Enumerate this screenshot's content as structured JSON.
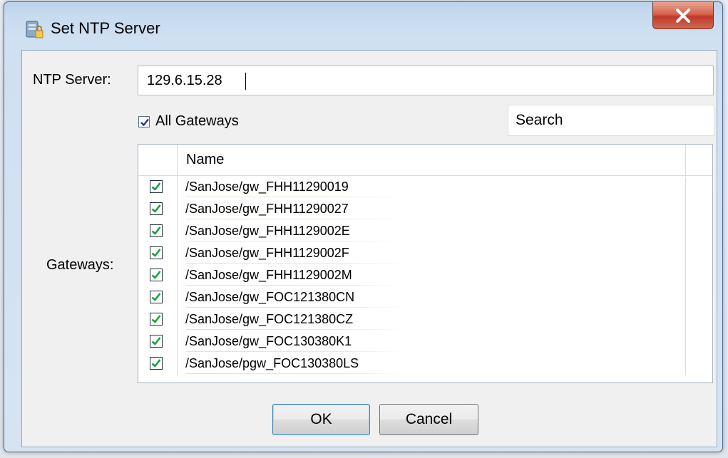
{
  "window": {
    "title": "Set NTP Server",
    "close_glyph": "X"
  },
  "form": {
    "ntp_label": "NTP Server:",
    "ntp_value": "129.6.15.28",
    "all_gateways_label": "All Gateways",
    "all_gateways_checked": true,
    "search_value": "Search",
    "gateways_label": "Gateways:"
  },
  "table": {
    "header_name": "Name",
    "rows": [
      {
        "name": "/SanJose/gw_FHH11290019",
        "checked": true
      },
      {
        "name": "/SanJose/gw_FHH11290027",
        "checked": true
      },
      {
        "name": "/SanJose/gw_FHH1129002E",
        "checked": true
      },
      {
        "name": "/SanJose/gw_FHH1129002F",
        "checked": true
      },
      {
        "name": "/SanJose/gw_FHH1129002M",
        "checked": true
      },
      {
        "name": "/SanJose/gw_FOC121380CN",
        "checked": true
      },
      {
        "name": "/SanJose/gw_FOC121380CZ",
        "checked": true
      },
      {
        "name": "/SanJose/gw_FOC130380K1",
        "checked": true
      },
      {
        "name": "/SanJose/pgw_FOC130380LS",
        "checked": true
      }
    ]
  },
  "buttons": {
    "ok_label": "OK",
    "cancel_label": "Cancel"
  },
  "colors": {
    "check_green": "#1e9e3a",
    "close_red": "#c0392b"
  }
}
